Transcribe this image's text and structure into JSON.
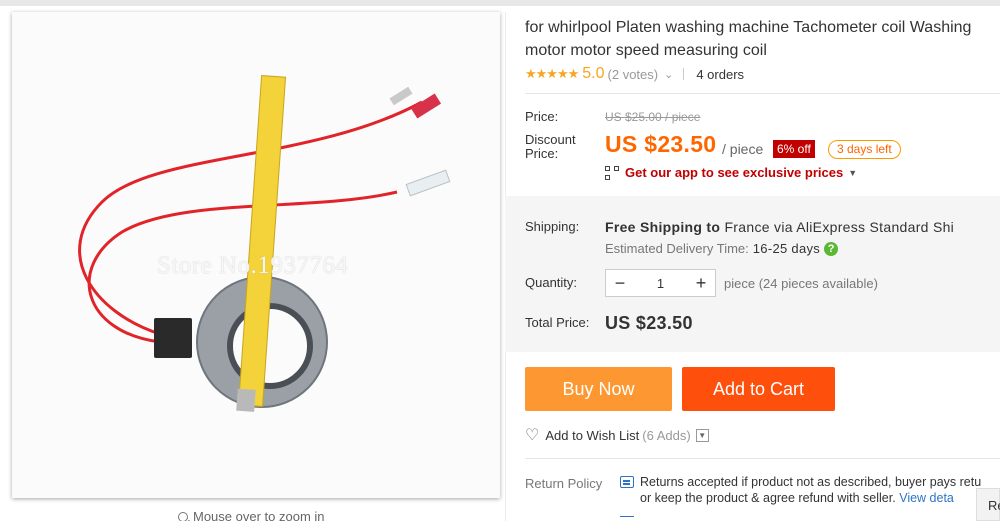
{
  "product": {
    "title_line1": "for whirlpool Platen washing machine Tachometer coil Washing",
    "title_line2": "motor motor speed measuring coil",
    "stars": "★★★★★",
    "rating": "5.0",
    "votes": "(2 votes)",
    "orders": "4 orders"
  },
  "image": {
    "watermark": "Store No.1937764",
    "zoom_hint": "Mouse over to zoom in"
  },
  "price": {
    "price_label": "Price:",
    "original": "US $25.00 / piece",
    "discount_label_1": "Discount",
    "discount_label_2": "Price:",
    "discount_price": "US $23.50",
    "per_piece": "/ piece",
    "off_badge": "6% off",
    "days_left": "3 days left",
    "app_promo": "Get our app to see exclusive prices"
  },
  "shipping": {
    "label": "Shipping:",
    "free": "Free Shipping to",
    "destination": "France via AliExpress Standard Shi",
    "delivery_label": "Estimated Delivery Time:",
    "delivery_days": "16-25 days",
    "help": "?"
  },
  "quantity": {
    "label": "Quantity:",
    "minus": "−",
    "value": "1",
    "plus": "+",
    "available": "piece (24 pieces available)"
  },
  "total": {
    "label": "Total Price:",
    "value": "US $23.50"
  },
  "actions": {
    "buy_now": "Buy Now",
    "add_to_cart": "Add to Cart",
    "wishlist": "Add to Wish List",
    "wishlist_count": "(6 Adds)"
  },
  "return_policy": {
    "label": "Return Policy",
    "line1": "Returns accepted if product not as described, buyer pays retu",
    "line2": "or keep the product & agree refund with seller.",
    "link": "View deta"
  },
  "corner_tab": "Re",
  "colors": {
    "accent_orange": "#ff6600",
    "buy_now": "#fd9731",
    "add_to_cart": "#ff4f0d",
    "star": "#f5a623",
    "badge_red": "#c10000"
  }
}
